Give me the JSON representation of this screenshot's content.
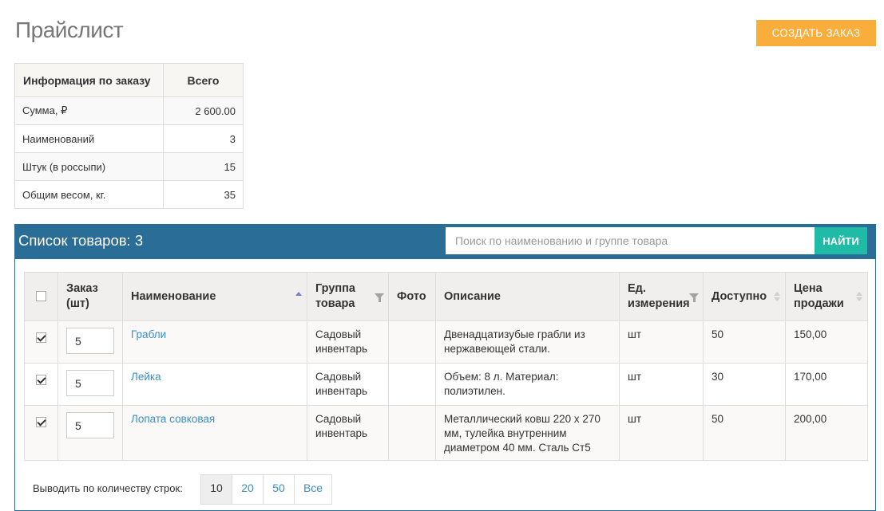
{
  "page": {
    "title": "Прайслист"
  },
  "actions": {
    "create_order": "Создать заказ"
  },
  "summary": {
    "headers": [
      "Информация по заказу",
      "Всего"
    ],
    "rows": [
      {
        "label": "Сумма, ₽",
        "value": "2 600.00"
      },
      {
        "label": "Наименований",
        "value": "3"
      },
      {
        "label": "Штук (в россыпи)",
        "value": "15"
      },
      {
        "label": "Общим весом, кг.",
        "value": "35"
      }
    ]
  },
  "goods": {
    "title": "Список товаров: 3",
    "search_placeholder": "Поиск по наименованию и группе товара",
    "search_button": "Найти",
    "columns": {
      "order": "Заказ (шт)",
      "name": "Наименование",
      "group": "Группа товара",
      "photo": "Фото",
      "description": "Описание",
      "unit": "Ед. измерения",
      "available": "Доступно",
      "price": "Цена продажи"
    },
    "rows": [
      {
        "checked": true,
        "qty": "5",
        "name": "Грабли",
        "group": "Садовый инвентарь",
        "description": "Двенадцатизубые грабли из нержавеющей стали.",
        "unit": "шт",
        "available": "50",
        "price": "150,00"
      },
      {
        "checked": true,
        "qty": "5",
        "name": "Лейка",
        "group": "Садовый инвентарь",
        "description": "Объем: 8 л. Материал: полиэтилен.",
        "unit": "шт",
        "available": "30",
        "price": "170,00"
      },
      {
        "checked": true,
        "qty": "5",
        "name": "Лопата совковая",
        "group": "Садовый инвентарь",
        "description": "Металлический ковш 220 х 270 мм, тулейка внутренним диаметром 40 мм. Сталь Ст5",
        "unit": "шт",
        "available": "50",
        "price": "200,00"
      }
    ]
  },
  "pager": {
    "label": "Выводить по количеству строк:",
    "options": [
      "10",
      "20",
      "50",
      "Все"
    ],
    "selected": "10"
  },
  "colors": {
    "accent_orange": "#f9ad3b",
    "panel_blue": "#2a6d97",
    "search_teal": "#1fbba6",
    "link_blue": "#3a8fc7"
  }
}
